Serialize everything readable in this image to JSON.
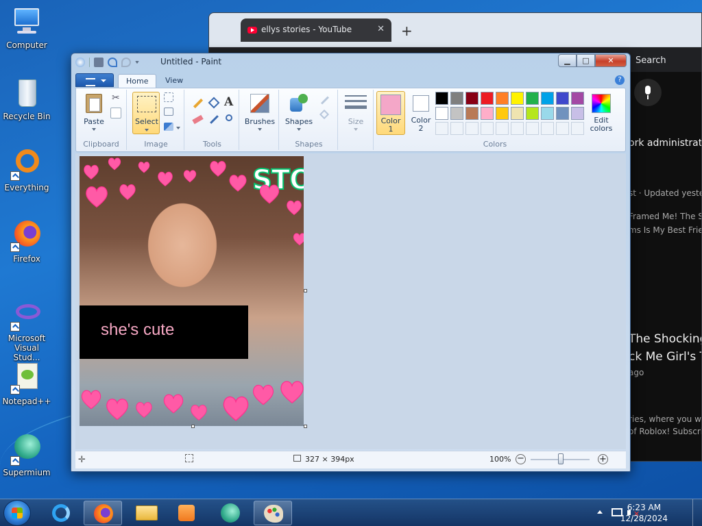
{
  "desktop": {
    "icons": [
      {
        "label": "Computer"
      },
      {
        "label": "Recycle Bin"
      },
      {
        "label": "Everything"
      },
      {
        "label": "Firefox"
      },
      {
        "label": "Microsoft Visual Stud..."
      },
      {
        "label": "Notepad++"
      },
      {
        "label": "Supermium"
      }
    ]
  },
  "browser": {
    "tab_title": "ellys stories - YouTube",
    "tab_close": "✕",
    "new_tab": "+",
    "search_label": "Search",
    "texts": [
      "ork administrator",
      "st · Updated yesterd",
      "Framed Me! The Sho",
      "ms Is My Best Frien",
      "The Shocking",
      "ck Me Girl's T",
      "ago",
      "ries, where you will",
      "of Roblox! Subscrib"
    ]
  },
  "paint": {
    "title": "Untitled - Paint",
    "tabs": {
      "home": "Home",
      "view": "View"
    },
    "help": "?",
    "groups": {
      "clipboard": "Clipboard",
      "image": "Image",
      "tools": "Tools",
      "shapes": "Shapes",
      "colors": "Colors"
    },
    "buttons": {
      "paste": "Paste",
      "select": "Select",
      "brushes": "Brushes",
      "shapes": "Shapes",
      "size": "Size",
      "color1_line1": "Color",
      "color1_line2": "1",
      "color2_line1": "Color",
      "color2_line2": "2",
      "edit_colors_line1": "Edit",
      "edit_colors_line2": "colors"
    },
    "color1": "#f4a7c8",
    "color2": "#ffffff",
    "palette_row1": [
      "#000000",
      "#7f7f7f",
      "#880015",
      "#ed1c24",
      "#ff7f27",
      "#fff200",
      "#22b14c",
      "#00a2e8",
      "#3f48cc",
      "#a349a4"
    ],
    "palette_row2": [
      "#ffffff",
      "#c3c3c3",
      "#b97a57",
      "#ffaec9",
      "#ffc90e",
      "#efe4b0",
      "#b5e61d",
      "#99d9ea",
      "#7092be",
      "#c8bfe7"
    ],
    "canvas": {
      "banner_text": "STO",
      "caption_text": "she's cute",
      "caption_color": "#f7a8c4"
    },
    "status": {
      "dimensions": "327 × 394px",
      "zoom": "100%",
      "zoom_minus": "−",
      "zoom_plus": "+",
      "move_glyph": "✛"
    }
  },
  "taskbar": {
    "time": "6:23 AM",
    "date": "12/28/2024"
  }
}
